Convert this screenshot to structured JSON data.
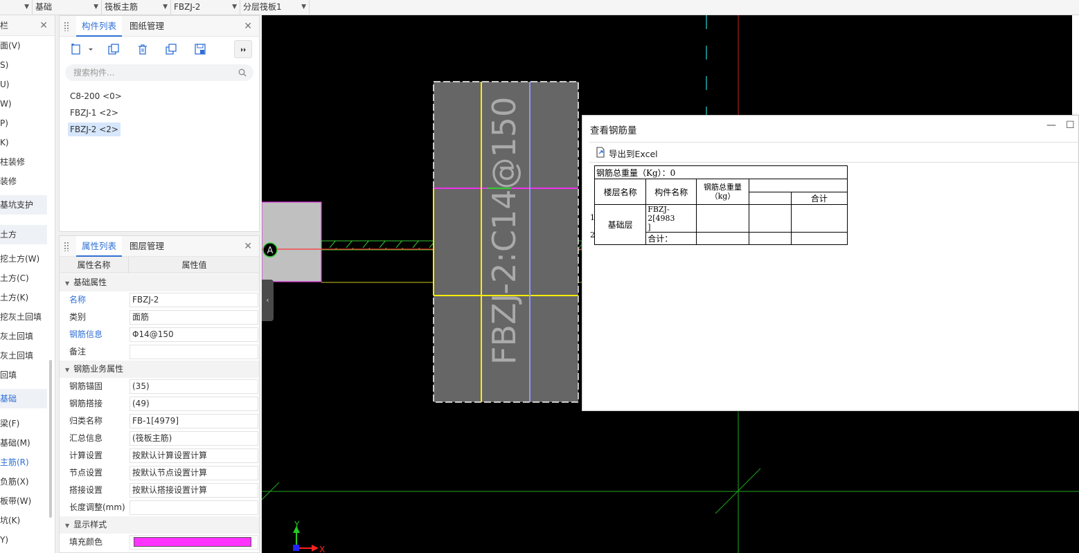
{
  "topbar": {
    "dropdowns": [
      {
        "label": "",
        "x": 0
      },
      {
        "label": "基础"
      },
      {
        "label": "筏板主筋"
      },
      {
        "label": "FBZJ-2"
      },
      {
        "label": "分层筏板1"
      }
    ]
  },
  "nav": {
    "title": "栏",
    "close": "✕",
    "items": [
      "面(V)",
      "S)",
      "U)",
      "W)",
      "P)",
      "K)",
      "柱装修",
      "装修",
      "基坑支护",
      "土方",
      "挖土方(W)",
      "土方(C)",
      "土方(K)",
      "挖灰土回填",
      "灰土回填",
      "灰土回填",
      "回填",
      "基础",
      "梁(F)",
      "基础(M)",
      "主筋(R)",
      "负筋(X)",
      "板带(W)",
      "坑(K)",
      "Y)"
    ]
  },
  "component_panel": {
    "tabs": [
      "构件列表",
      "图纸管理"
    ],
    "close": "✕",
    "search_placeholder": "搜索构件...",
    "items": [
      "C8-200 <0>",
      "FBZJ-1 <2>",
      "FBZJ-2 <2>"
    ],
    "selected_index": 2
  },
  "property_panel": {
    "tabs": [
      "属性列表",
      "图层管理"
    ],
    "close": "✕",
    "header": {
      "name": "属性名称",
      "value": "属性值"
    },
    "groups": {
      "basic": "基础属性",
      "business": "钢筋业务属性",
      "display": "显示样式"
    },
    "rows": [
      {
        "name": "名称",
        "value": "FBZJ-2"
      },
      {
        "name": "类别",
        "value": "面筋"
      },
      {
        "name": "钢筋信息",
        "value": "Φ14@150"
      },
      {
        "name": "备注",
        "value": ""
      },
      {
        "name": "钢筋锚固",
        "value": "(35)"
      },
      {
        "name": "钢筋搭接",
        "value": "(49)"
      },
      {
        "name": "归类名称",
        "value": "FB-1[4979]"
      },
      {
        "name": "汇总信息",
        "value": "(筏板主筋)"
      },
      {
        "name": "计算设置",
        "value": "按默认计算设置计算"
      },
      {
        "name": "节点设置",
        "value": "按默认节点设置计算"
      },
      {
        "name": "搭接设置",
        "value": "按默认搭接设置计算"
      },
      {
        "name": "长度调整(mm)",
        "value": ""
      },
      {
        "name": "填充颜色",
        "value": ""
      }
    ],
    "fill_color": "#ff33ff"
  },
  "canvas": {
    "rebar_label": "FBZJ-2:C14@150",
    "axis_label": "A",
    "axis_x": "X",
    "axis_y": "Y"
  },
  "dialog": {
    "title": "查看钢筋量",
    "minimize": "—",
    "maximize": "☐",
    "export_label": "导出到Excel",
    "total_label": "钢筋总重量（Kg）：0",
    "col_floor": "楼层名称",
    "col_component": "构件名称",
    "col_total_line1": "钢筋总重量",
    "col_total_line2": "（kg）",
    "col_sum": "合计",
    "floor_name": "基础层",
    "component_name_line1": "FBZJ-2[4983",
    "component_name_line2": "]",
    "subtotal_label": "合计：",
    "row_numbers": [
      "1",
      "2"
    ]
  }
}
